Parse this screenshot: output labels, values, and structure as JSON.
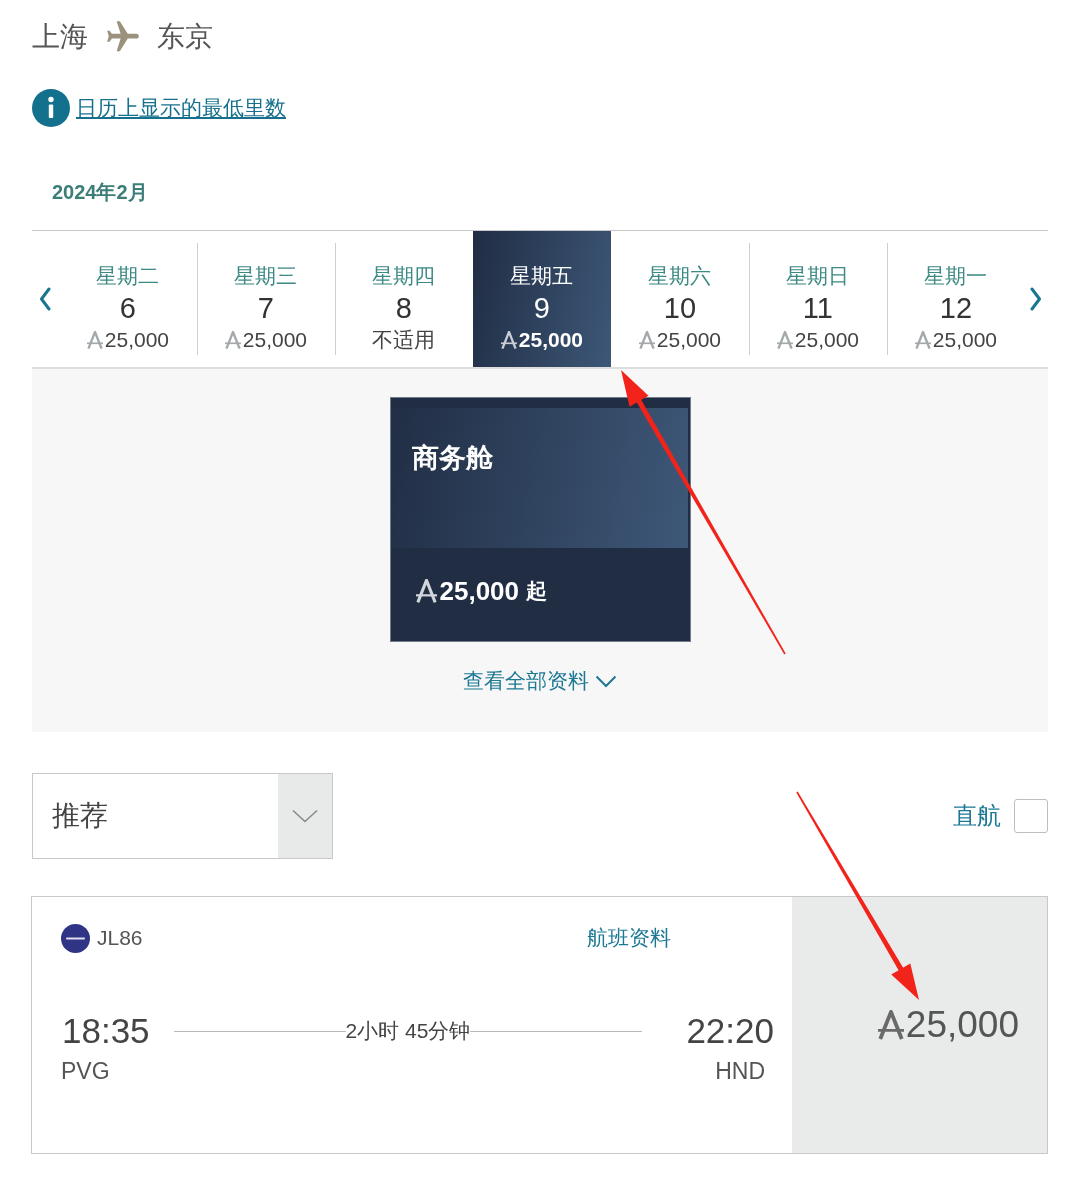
{
  "route": {
    "origin": "上海",
    "destination": "东京"
  },
  "info_link": {
    "label": "日历上显示的最低里数"
  },
  "calendar": {
    "month": "2024年2月",
    "days": [
      {
        "weekday": "星期二",
        "date": "6",
        "kind": "miles",
        "price": "25,000",
        "selected": false
      },
      {
        "weekday": "星期三",
        "date": "7",
        "kind": "miles",
        "price": "25,000",
        "selected": false
      },
      {
        "weekday": "星期四",
        "date": "8",
        "kind": "text",
        "price": "不适用",
        "selected": false
      },
      {
        "weekday": "星期五",
        "date": "9",
        "kind": "miles",
        "price": "25,000",
        "selected": true
      },
      {
        "weekday": "星期六",
        "date": "10",
        "kind": "miles",
        "price": "25,000",
        "selected": false
      },
      {
        "weekday": "星期日",
        "date": "11",
        "kind": "miles",
        "price": "25,000",
        "selected": false
      },
      {
        "weekday": "星期一",
        "date": "12",
        "kind": "miles",
        "price": "25,000",
        "selected": false
      }
    ]
  },
  "cabins": [
    {
      "name": "商务舱",
      "price": "25,000",
      "suffix": "起"
    }
  ],
  "details_link": {
    "label": "查看全部资料"
  },
  "sort": {
    "value": "推荐"
  },
  "nonstop_filter": {
    "label": "直航",
    "checked": false
  },
  "flights": [
    {
      "flight_number": "JL86",
      "details_link": "航班资料",
      "departure": {
        "time": "18:35",
        "airport": "PVG"
      },
      "duration": "2小时 45分钟",
      "arrival": {
        "time": "22:20",
        "airport": "HND"
      },
      "price": "25,000"
    }
  ]
}
